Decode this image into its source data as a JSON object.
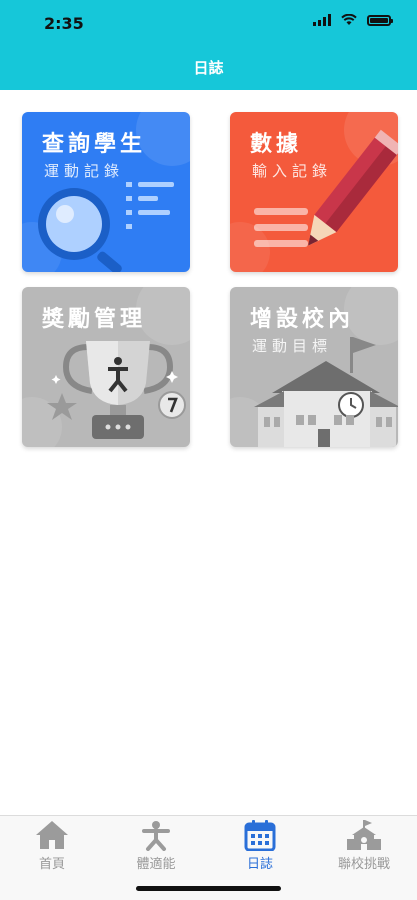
{
  "status": {
    "time": "2:35"
  },
  "header": {
    "title": "日誌"
  },
  "cards": [
    {
      "title": "查詢學生",
      "subtitle": "運動記錄",
      "color": "#2f7df3",
      "icon": "magnifier-icon"
    },
    {
      "title": "數據",
      "subtitle": "輸入記錄",
      "color": "#f45a3c",
      "icon": "pencil-icon"
    },
    {
      "title": "獎勵管理",
      "subtitle": "",
      "color": "#b8b8b8",
      "icon": "trophy-icon"
    },
    {
      "title": "增設校內",
      "subtitle": "運動目標",
      "color": "#b8b8b8",
      "icon": "school-icon"
    }
  ],
  "tabs": [
    {
      "label": "首頁",
      "icon": "home-icon"
    },
    {
      "label": "體適能",
      "icon": "fitness-icon"
    },
    {
      "label": "日誌",
      "icon": "calendar-icon"
    },
    {
      "label": "聯校挑戰",
      "icon": "school-challenge-icon"
    }
  ],
  "active_tab": 2,
  "colors": {
    "header": "#16c7d9",
    "tab_active": "#2a6fd8",
    "tab_inactive": "#999999"
  }
}
